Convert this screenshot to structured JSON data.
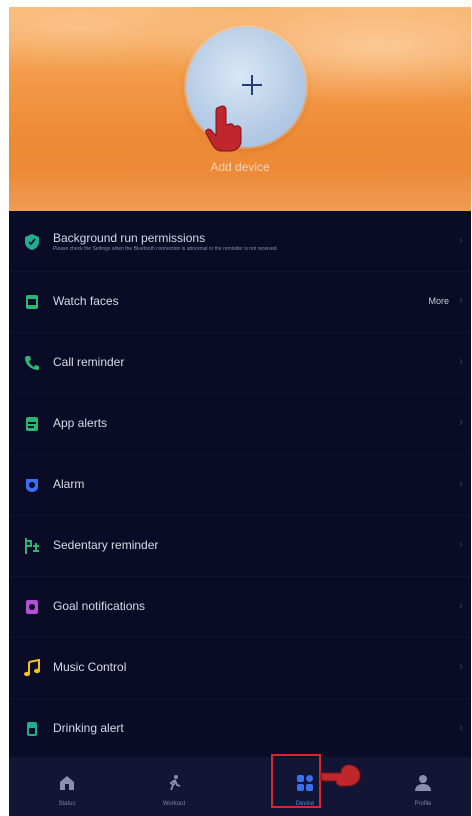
{
  "header": {
    "add_label": "Add device"
  },
  "list": {
    "background_permissions": {
      "label": "Background run permissions",
      "description": "Please check the Settings when the Bluetooth connection is abnormal or the reminder is not received."
    },
    "watch_faces": {
      "label": "Watch faces",
      "more": "More"
    },
    "call_reminder": {
      "label": "Call reminder"
    },
    "app_alerts": {
      "label": "App alerts"
    },
    "alarm": {
      "label": "Alarm"
    },
    "sedentary": {
      "label": "Sedentary reminder"
    },
    "goal": {
      "label": "Goal notifications"
    },
    "music": {
      "label": "Music Control"
    },
    "drinking": {
      "label": "Drinking alert"
    }
  },
  "nav": {
    "items": [
      {
        "label": "Status"
      },
      {
        "label": "Workout"
      },
      {
        "label": "Device"
      },
      {
        "label": "Profile"
      }
    ]
  },
  "colors": {
    "accent": "#3a6ff0",
    "highlight": "#d8262a",
    "list_background": "#0a0b26"
  }
}
